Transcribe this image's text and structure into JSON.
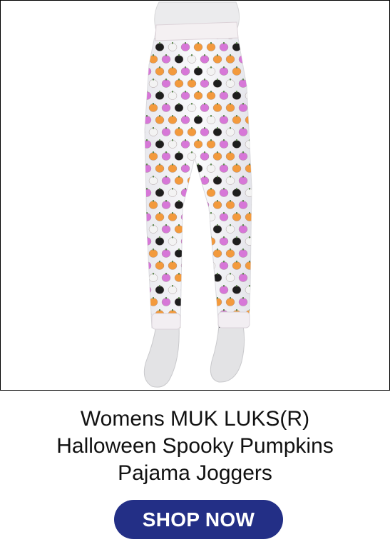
{
  "product": {
    "title_lines": [
      "Womens MUK LUKS(R)",
      "Halloween Spooky Pumpkins",
      "Pajama Joggers"
    ]
  },
  "cta": {
    "label": "SHOP NOW"
  },
  "colors": {
    "button_bg": "#232f86",
    "pumpkin_orange": "#f39a3d",
    "pumpkin_pink": "#d777d8",
    "pumpkin_black": "#1e1e1e",
    "pumpkin_white": "#f3f3f3",
    "mannequin": "#e3e3e5"
  },
  "image": {
    "icon": "product-photo"
  }
}
